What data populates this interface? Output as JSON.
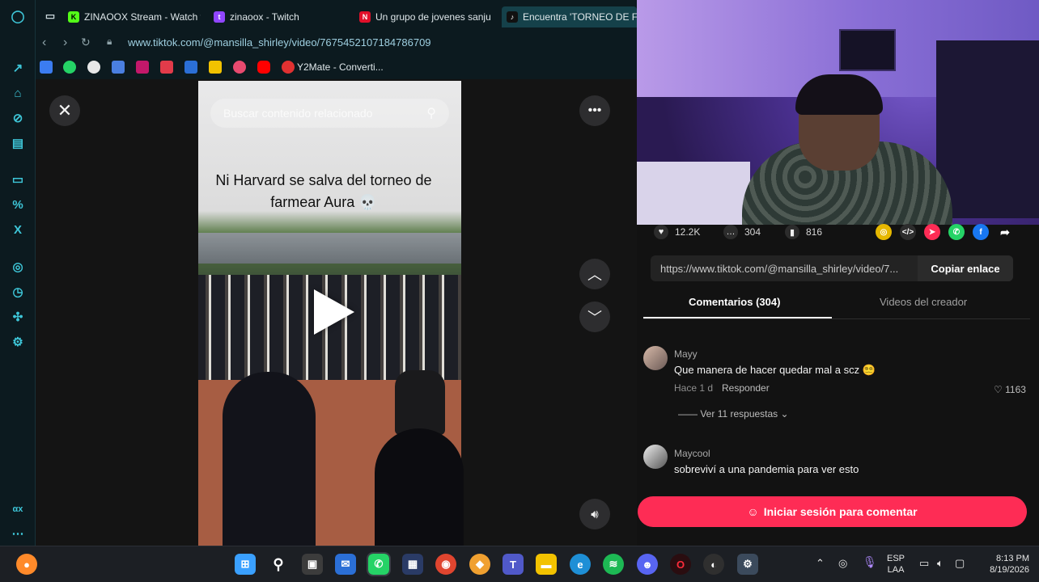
{
  "browser": {
    "tabs": [
      {
        "label": "ZINAOOX Stream - Watch t",
        "icon": "kick-icon",
        "color": "#53fc18"
      },
      {
        "label": "zinaoox - Twitch",
        "icon": "twitch-icon",
        "color": "#9146ff"
      },
      {
        "label": "Un grupo de jovenes sanju",
        "icon": "news-icon",
        "color": "#e0102a"
      },
      {
        "label": "Encuentra 'TORNEO DE FA",
        "icon": "tiktok-icon",
        "color": "#111111"
      }
    ],
    "url": "www.tiktok.com/@mansilla_shirley/video/7675452107184786709",
    "bookmark_label": "Y2Mate - Converti..."
  },
  "video": {
    "search_placeholder": "Buscar contenido relacionado",
    "caption": "Ni Harvard se salva del torneo de farmear Aura 💀"
  },
  "stats": {
    "likes": "12.2K",
    "comments": "304",
    "saves": "816"
  },
  "share": {
    "link": "https://www.tiktok.com/@mansilla_shirley/video/7...",
    "copy_label": "Copiar enlace"
  },
  "panel_tabs": [
    "Comentarios (304)",
    "Videos del creador"
  ],
  "comments": [
    {
      "user": "Mayy",
      "text": "Que manera de hacer quedar mal a scz 😵‍💫",
      "time": "Hace 1 d",
      "reply": "Responder",
      "likes": "1163",
      "replies": "Ver 11 respuestas"
    },
    {
      "user": "Maycool",
      "text": "sobreviví a una pandemia para ver esto"
    }
  ],
  "login_label": "Iniciar sesión para comentar",
  "tray": {
    "lang_top": "ESP",
    "lang_bottom": "LAA",
    "time": "8:13 PM",
    "date": "8/19/2026"
  },
  "sidebar_footer": "αx",
  "colors": {
    "accent": "#fe2c55",
    "sidebar": "#3ec6d8"
  }
}
